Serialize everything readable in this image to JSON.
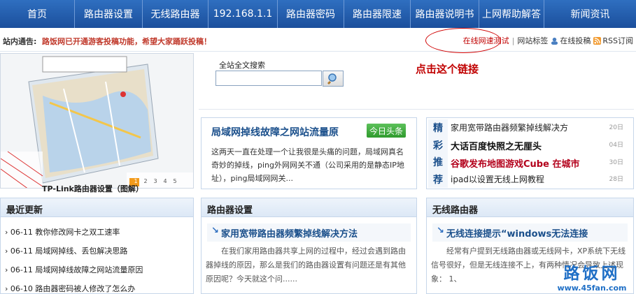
{
  "nav": {
    "items": [
      "首页",
      "路由器设置",
      "无线路由器",
      "192.168.1.1",
      "路由器密码",
      "路由器限速",
      "路由器说明书",
      "上网帮助解答",
      "新闻资讯"
    ]
  },
  "notice": {
    "label": "站内通告:",
    "text": "路饭网已开通游客投稿功能，希望大家踊跃投稿！",
    "links": {
      "speed_test": "在线网速测试",
      "tags": "网站标签",
      "submit": "在线投稿",
      "rss": "RSS订阅"
    }
  },
  "map": {
    "caption": "TP-Link路由器设置（图解）",
    "page_numbers": [
      "1",
      "2",
      "3",
      "4",
      "5"
    ]
  },
  "search": {
    "label": "全站全文搜索",
    "placeholder": ""
  },
  "annotation": "点击这个链接",
  "headline": {
    "title": "局域网掉线故障之网站流量原",
    "tag": "今日头条",
    "body": "这两天一直在处理一个让我很是头痛的问题，局域网真名奇妙的掉线，ping外网网关不通（公司采用的是静态IP地址），ping局域网网关..."
  },
  "recommend": {
    "side_chars": [
      "精",
      "彩",
      "推",
      "荐"
    ],
    "items": [
      {
        "title": "家用宽带路由器频繁掉线解决方",
        "date": "20日"
      },
      {
        "title": "大话百度快照之无厘头",
        "date": "04日"
      },
      {
        "title": "谷歌发布地图游戏Cube 在城市",
        "date": "30日"
      },
      {
        "title": "ipad以设置无线上网教程",
        "date": "28日"
      }
    ]
  },
  "latest": {
    "heading": "最近更新",
    "items": [
      "06-11 教你修改网卡之双工速率",
      "06-11 局域网掉线、丢包解决思路",
      "06-11 局域网掉线故障之网站流量原因",
      "06-10 路由器密码被人修改了怎么办"
    ]
  },
  "router_settings": {
    "heading": "路由器设置",
    "article_title": "家用宽带路由器频繁掉线解决方法",
    "body": "在我们家用路由器共享上网的过程中，经过会遇到路由器掉线的原因，那么是我们的路由器设置有问题还是有其他原因呢？今天就这个问......"
  },
  "wireless": {
    "heading": "无线路由器",
    "article_title": "无线连接提示“windows无法连接",
    "body": "经常有户提到无线路由器或无线网卡，XP系统下无线信号很好，但是无线连接不上，有两种情况会导致上述现象： 1、"
  },
  "watermark": {
    "brand": "路饭网",
    "url": "www.45fan.com"
  },
  "colors": {
    "nav_bg": "#1b4f9c",
    "accent_red": "#c00000",
    "link_blue": "#1a4f8b",
    "tag_green": "#2f9a2d"
  }
}
